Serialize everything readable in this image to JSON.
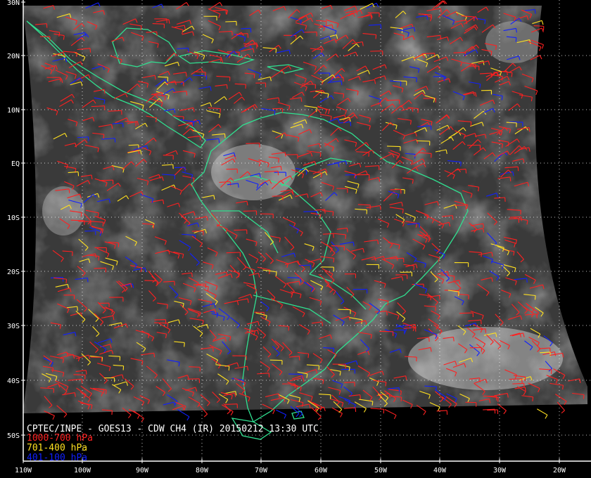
{
  "product_title": "CPTEC/INPE - GOES13 - CDW CH4 (IR) 20150212 13:30 UTC",
  "legend": [
    {
      "label": "1000-700 hPa",
      "color": "#ff2020"
    },
    {
      "label": "701-400 hPa",
      "color": "#ffe020"
    },
    {
      "label": "401-100 hPa",
      "color": "#1020ff"
    }
  ],
  "lat_labels": [
    "30N",
    "20N",
    "10N",
    "EQ",
    "10S",
    "20S",
    "30S",
    "40S",
    "50S"
  ],
  "lon_labels": [
    "110W",
    "100W",
    "90W",
    "80W",
    "70W",
    "60W",
    "50W",
    "40W",
    "30W",
    "20W"
  ],
  "colors": {
    "background": "#000000",
    "coastline": "#30e090",
    "grid": "#ffffff",
    "cloud_dark": "#3a3a3a"
  }
}
